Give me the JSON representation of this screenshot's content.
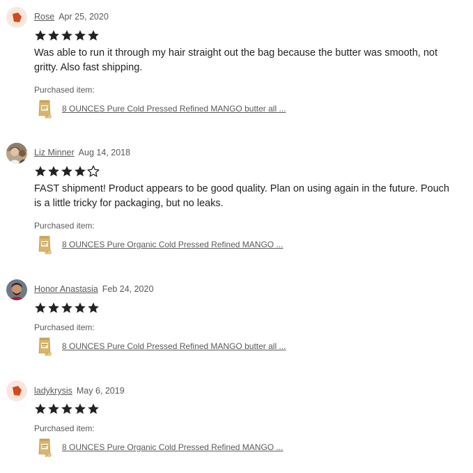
{
  "reviews": [
    {
      "user": "Rose",
      "date": "Apr 25, 2020",
      "rating": 5,
      "avatar": "default-avatar-icon",
      "text": "Was able to run it through my hair straight out the bag because the butter was smooth, not gritty. Also fast shipping.",
      "purchased_label": "Purchased item:",
      "item_title": "8 OUNCES Pure Cold Pressed Refined MANGO butter all ..."
    },
    {
      "user": "Liz Minner",
      "date": "Aug 14, 2018",
      "rating": 4,
      "avatar": "user-photo",
      "text": "FAST shipment! Product appears to be good quality. Plan on using again in the future. Pouch is a little tricky for packaging, but no leaks.",
      "purchased_label": "Purchased item:",
      "item_title": "8 OUNCES Pure Organic Cold Pressed Refined MANGO ..."
    },
    {
      "user": "Honor Anastasia",
      "date": "Feb 24, 2020",
      "rating": 5,
      "avatar": "user-photo",
      "text": "",
      "purchased_label": "Purchased item:",
      "item_title": "8 OUNCES Pure Cold Pressed Refined MANGO butter all ..."
    },
    {
      "user": "ladykrysis",
      "date": "May 6, 2019",
      "rating": 5,
      "avatar": "default-avatar-icon",
      "text": "",
      "purchased_label": "Purchased item:",
      "item_title": "8 OUNCES Pure Organic Cold Pressed Refined MANGO ..."
    }
  ],
  "colors": {
    "star": "#222222",
    "default_avatar_bg": "#fbe6df",
    "default_avatar_shape": "#d04a1e",
    "meta_text": "#595959"
  }
}
